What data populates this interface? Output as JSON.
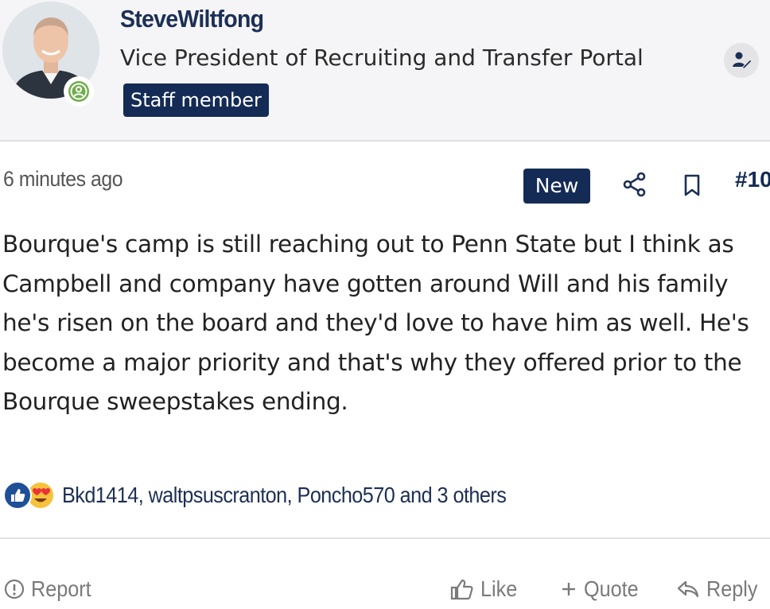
{
  "author": {
    "username": "SteveWiltfong",
    "title": "Vice President of Recruiting and Transfer Portal",
    "role_badge": "Staff member"
  },
  "post": {
    "time": "6 minutes ago",
    "new_badge": "New",
    "number": "#10",
    "body": "Bourque's camp is still reaching out to Penn State but I think as Campbell and company have gotten around Will and his family he's risen on the board and they'd love to have him as well. He's become a major priority and that's why they offered prior to the Bourque sweepstakes ending."
  },
  "reactions": {
    "icons": [
      "like-reaction-icon",
      "love-reaction-icon"
    ],
    "users_text": "Bkd1414, waltpsuscranton, Poncho570 and 3 others"
  },
  "actions": {
    "report": "Report",
    "like": "Like",
    "quote": "Quote",
    "reply": "Reply"
  },
  "colors": {
    "navy": "#142b55",
    "online_green": "#6fae4c",
    "muted": "#7a7a7a"
  }
}
